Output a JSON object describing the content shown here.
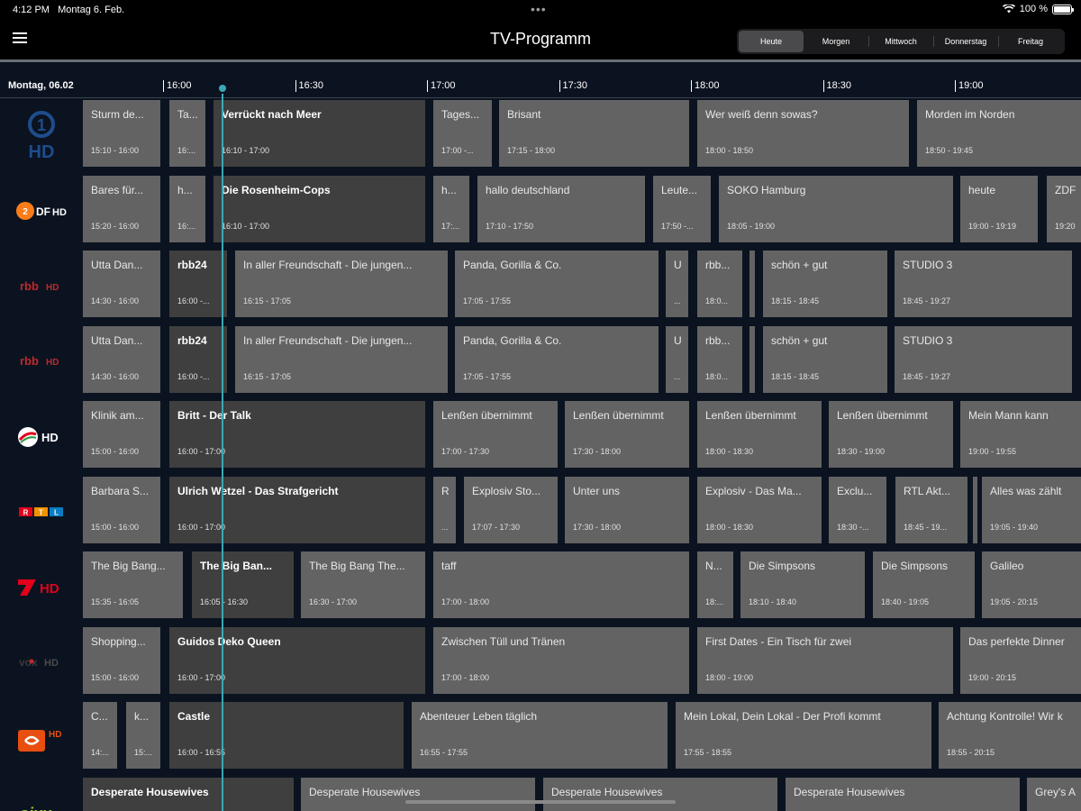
{
  "status": {
    "time": "4:12 PM",
    "date": "Montag 6. Feb.",
    "battery": "100 %"
  },
  "navbar": {
    "title": "TV-Programm"
  },
  "days": [
    "Heute",
    "Morgen",
    "Mittwoch",
    "Donnerstag",
    "Freitag"
  ],
  "active_day": 0,
  "timeline": {
    "date": "Montag, 06.02",
    "ticks": [
      "16:00",
      "16:30",
      "17:00",
      "17:30",
      "18:00",
      "18:30",
      "19:00"
    ],
    "now": "16:12"
  },
  "channels": [
    {
      "logo": "das-erste-hd",
      "programs": [
        {
          "title": "Sturm de...",
          "time": "15:10 - 16:00"
        },
        {
          "title": "Ta...",
          "time": "16:..."
        },
        {
          "title": "Verrückt nach Meer",
          "time": "16:10 - 17:00",
          "live": true
        },
        {
          "title": "Tages...",
          "time": "17:00 -..."
        },
        {
          "title": "Brisant",
          "time": "17:15 - 18:00"
        },
        {
          "title": "Wer weiß denn sowas?",
          "time": "18:00 - 18:50"
        },
        {
          "title": "Morden im Norden",
          "time": "18:50 - 19:45"
        }
      ]
    },
    {
      "logo": "zdf-hd",
      "programs": [
        {
          "title": "Bares für...",
          "time": "15:20 - 16:00"
        },
        {
          "title": "h...",
          "time": "16:..."
        },
        {
          "title": "Die Rosenheim-Cops",
          "time": "16:10 - 17:00",
          "live": true
        },
        {
          "title": "h...",
          "time": "17:..."
        },
        {
          "title": "hallo deutschland",
          "time": "17:10 - 17:50"
        },
        {
          "title": "Leute...",
          "time": "17:50 -..."
        },
        {
          "title": "SOKO Hamburg",
          "time": "18:05 - 19:00"
        },
        {
          "title": "heute",
          "time": "19:00 - 19:19"
        },
        {
          "title": "ZDF",
          "time": "19:20"
        }
      ]
    },
    {
      "logo": "rbb-hd",
      "programs": [
        {
          "title": "Utta Dan...",
          "time": "14:30 - 16:00"
        },
        {
          "title": "rbb24",
          "time": "16:00 -...",
          "live": true
        },
        {
          "title": "In aller Freundschaft - Die jungen...",
          "time": "16:15 - 17:05"
        },
        {
          "title": "Panda, Gorilla & Co.",
          "time": "17:05 - 17:55"
        },
        {
          "title": "U",
          "time": "..."
        },
        {
          "title": "rbb...",
          "time": "18:0..."
        },
        {
          "title": "",
          "time": ""
        },
        {
          "title": "schön + gut",
          "time": "18:15 - 18:45"
        },
        {
          "title": "STUDIO 3",
          "time": "18:45 - 19:27"
        }
      ]
    },
    {
      "logo": "rbb-hd",
      "programs": [
        {
          "title": "Utta Dan...",
          "time": "14:30 - 16:00"
        },
        {
          "title": "rbb24",
          "time": "16:00 -...",
          "live": true
        },
        {
          "title": "In aller Freundschaft - Die jungen...",
          "time": "16:15 - 17:05"
        },
        {
          "title": "Panda, Gorilla & Co.",
          "time": "17:05 - 17:55"
        },
        {
          "title": "U",
          "time": "..."
        },
        {
          "title": "rbb...",
          "time": "18:0..."
        },
        {
          "title": "",
          "time": ""
        },
        {
          "title": "schön + gut",
          "time": "18:15 - 18:45"
        },
        {
          "title": "STUDIO 3",
          "time": "18:45 - 19:27"
        }
      ]
    },
    {
      "logo": "sat1-hd",
      "programs": [
        {
          "title": "Klinik am...",
          "time": "15:00 - 16:00"
        },
        {
          "title": "Britt - Der Talk",
          "time": "16:00 - 17:00",
          "live": true
        },
        {
          "title": "Lenßen übernimmt",
          "time": "17:00 - 17:30"
        },
        {
          "title": "Lenßen übernimmt",
          "time": "17:30 - 18:00"
        },
        {
          "title": "Lenßen übernimmt",
          "time": "18:00 - 18:30"
        },
        {
          "title": "Lenßen übernimmt",
          "time": "18:30 - 19:00"
        },
        {
          "title": "Mein Mann kann",
          "time": "19:00 - 19:55"
        }
      ]
    },
    {
      "logo": "rtl",
      "programs": [
        {
          "title": "Barbara S...",
          "time": "15:00 - 16:00"
        },
        {
          "title": "Ulrich Wetzel - Das Strafgericht",
          "time": "16:00 - 17:00",
          "live": true
        },
        {
          "title": "R",
          "time": "..."
        },
        {
          "title": "Explosiv Sto...",
          "time": "17:07 - 17:30"
        },
        {
          "title": "Unter uns",
          "time": "17:30 - 18:00"
        },
        {
          "title": "Explosiv - Das Ma...",
          "time": "18:00 - 18:30"
        },
        {
          "title": "Exclu...",
          "time": "18:30 -..."
        },
        {
          "title": "RTL Akt...",
          "time": "18:45 - 19..."
        },
        {
          "title": "",
          "time": ""
        },
        {
          "title": "Alles was zählt",
          "time": "19:05 - 19:40"
        }
      ]
    },
    {
      "logo": "pro7-hd",
      "programs": [
        {
          "title": "The Big Bang...",
          "time": "15:35 - 16:05"
        },
        {
          "title": "The Big Ban...",
          "time": "16:05 - 16:30",
          "live": true
        },
        {
          "title": "The Big Bang The...",
          "time": "16:30 - 17:00"
        },
        {
          "title": "taff",
          "time": "17:00 - 18:00"
        },
        {
          "title": "N...",
          "time": "18:..."
        },
        {
          "title": "Die Simpsons",
          "time": "18:10 - 18:40"
        },
        {
          "title": "Die Simpsons",
          "time": "18:40 - 19:05"
        },
        {
          "title": "Galileo",
          "time": "19:05 - 20:15"
        }
      ]
    },
    {
      "logo": "vox-hd",
      "programs": [
        {
          "title": "Shopping...",
          "time": "15:00 - 16:00"
        },
        {
          "title": "Guidos Deko Queen",
          "time": "16:00 - 17:00",
          "live": true
        },
        {
          "title": "Zwischen Tüll und Tränen",
          "time": "17:00 - 18:00"
        },
        {
          "title": "First Dates - Ein Tisch für zwei",
          "time": "18:00 - 19:00"
        },
        {
          "title": "Das perfekte Dinner",
          "time": "19:00 - 20:15"
        }
      ]
    },
    {
      "logo": "kabel1-hd",
      "programs": [
        {
          "title": "C...",
          "time": "14:..."
        },
        {
          "title": "k...",
          "time": "15:..."
        },
        {
          "title": "Castle",
          "time": "16:00 - 16:55",
          "live": true
        },
        {
          "title": "Abenteuer Leben täglich",
          "time": "16:55 - 17:55"
        },
        {
          "title": "Mein Lokal, Dein Lokal - Der Profi kommt",
          "time": "17:55 - 18:55"
        },
        {
          "title": "Achtung Kontrolle! Wir k",
          "time": "18:55 - 20:15"
        }
      ]
    },
    {
      "logo": "sixx",
      "programs": [
        {
          "title": "Desperate Housewives",
          "time": "",
          "live": true
        },
        {
          "title": "Desperate Housewives",
          "time": ""
        },
        {
          "title": "Desperate Housewives",
          "time": ""
        },
        {
          "title": "Desperate Housewives",
          "time": ""
        },
        {
          "title": "Grey's A",
          "time": ""
        }
      ]
    }
  ]
}
